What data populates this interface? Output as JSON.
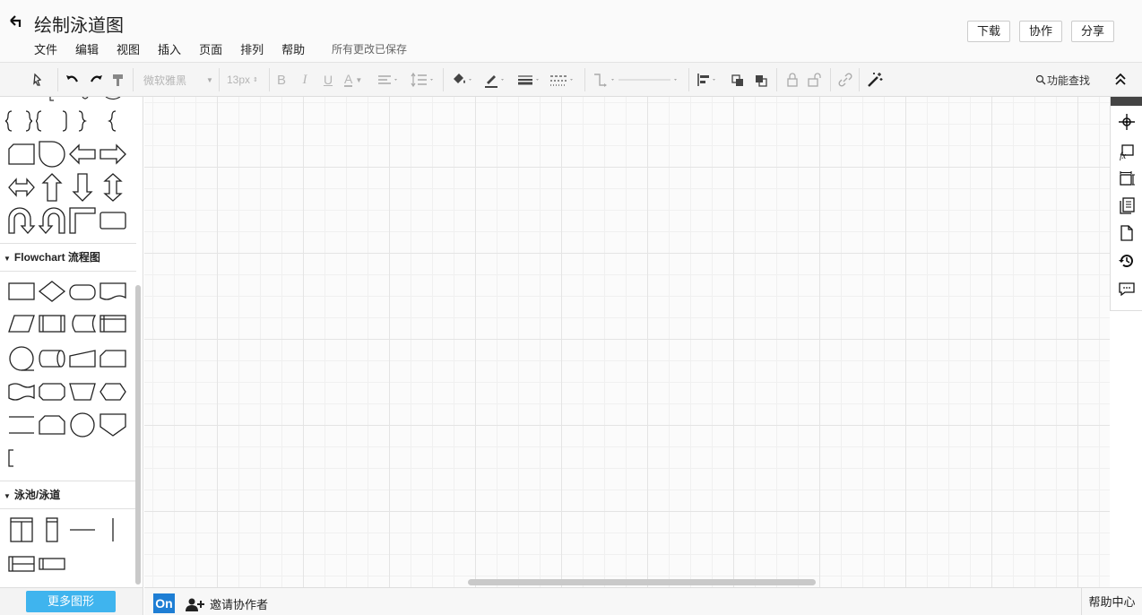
{
  "header": {
    "title": "绘制泳道图",
    "menu": [
      "文件",
      "编辑",
      "视图",
      "插入",
      "页面",
      "排列",
      "帮助"
    ],
    "save_status": "所有更改已保存",
    "download_label": "下载",
    "collab_label": "协作",
    "share_label": "分享"
  },
  "toolbar": {
    "font_family": "微软雅黑",
    "font_size": "13px",
    "bold": "B",
    "italic": "I",
    "underline": "U",
    "font_color": "A",
    "feature_search": "功能查找"
  },
  "left_panel": {
    "sections": [
      {
        "label": "Flowchart 流程图"
      },
      {
        "label": "泳池/泳道"
      }
    ],
    "more_shapes_label": "更多图形"
  },
  "bottom_bar": {
    "on_badge": "On",
    "invite_label": "邀请协作者",
    "help_label": "帮助中心"
  },
  "right_rail": {
    "icons": [
      "navigator-icon",
      "formula-icon",
      "size-position-icon",
      "pages-icon",
      "page-icon",
      "history-icon",
      "comment-icon"
    ]
  },
  "colors": {
    "accent": "#3fb4ee",
    "on_badge": "#1e7ed4"
  }
}
